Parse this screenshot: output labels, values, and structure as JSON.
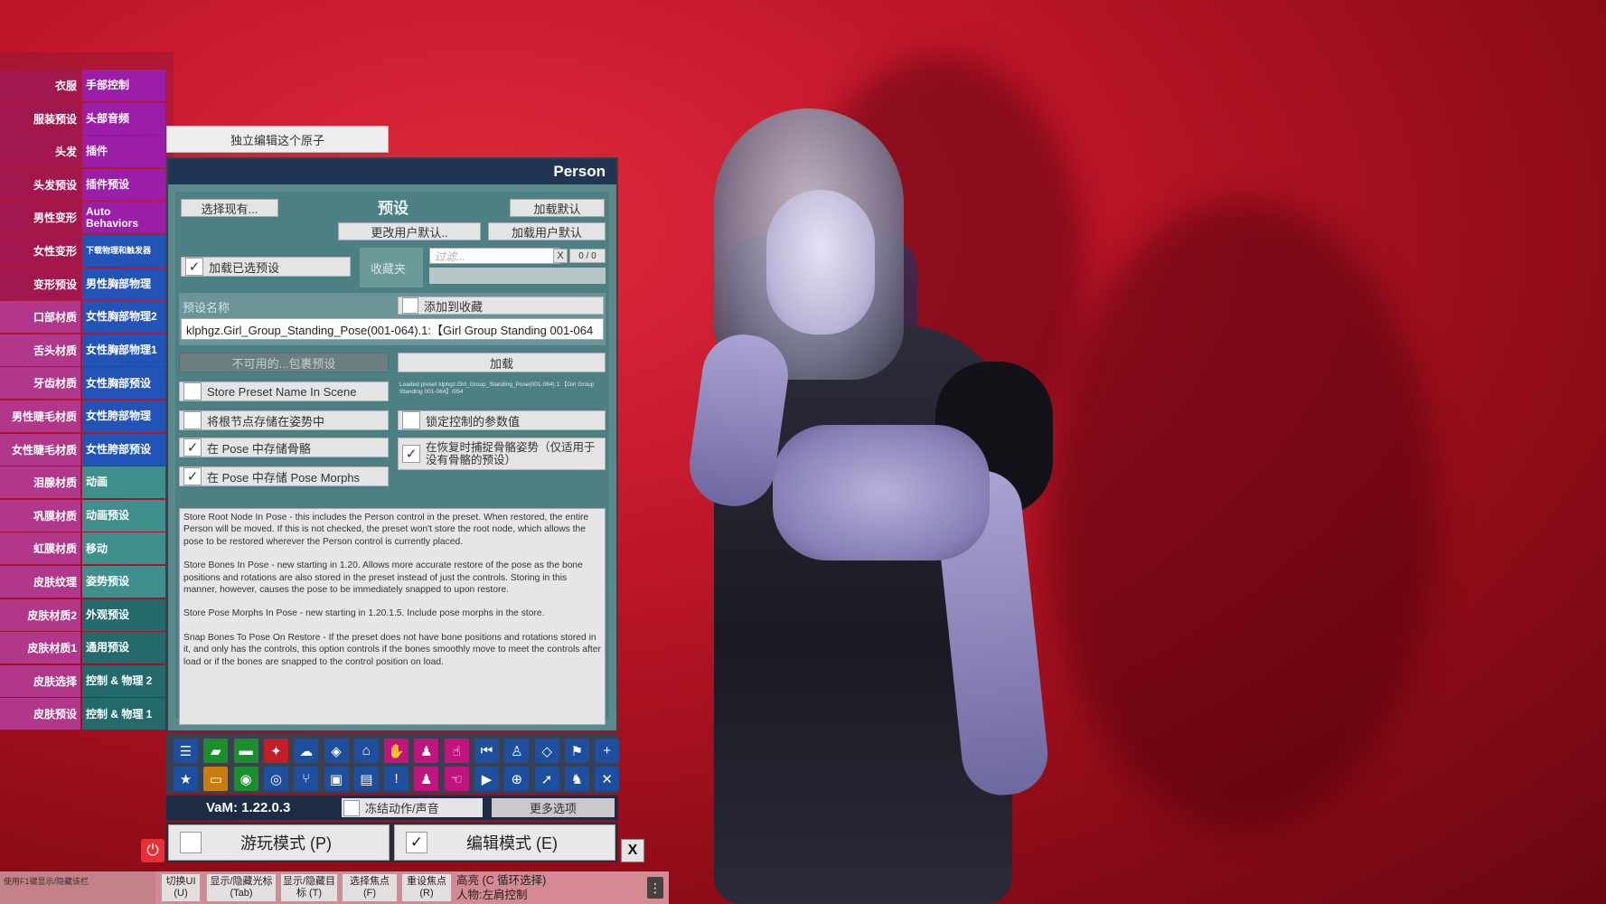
{
  "left_tabs": [
    {
      "left": "衣服",
      "right": "手部控制",
      "left_color": "#a3174f",
      "right_color": "#9b1ea8"
    },
    {
      "left": "服装预设",
      "right": "头部音频",
      "left_color": "#a3174f",
      "right_color": "#9b1ea8"
    },
    {
      "left": "头发",
      "right": "插件",
      "left_color": "#a3174f",
      "right_color": "#9b1ea8"
    },
    {
      "left": "头发预设",
      "right": "插件预设",
      "left_color": "#a3174f",
      "right_color": "#9b1ea8"
    },
    {
      "left": "男性变形",
      "right": "Auto Behaviors",
      "left_color": "#a3174f",
      "right_color": "#9b1ea8"
    },
    {
      "left": "女性变形",
      "right": "下载物理和触发器",
      "left_color": "#a3174f",
      "right_color": "#2254b8"
    },
    {
      "left": "变形预设",
      "right": "男性胸部物理",
      "left_color": "#a3174f",
      "right_color": "#2254b8"
    },
    {
      "left": "口部材质",
      "right": "女性胸部物理2",
      "left_color": "#b0378a",
      "right_color": "#2254b8"
    },
    {
      "left": "舌头材质",
      "right": "女性胸部物理1",
      "left_color": "#b0378a",
      "right_color": "#2254b8"
    },
    {
      "left": "牙齿材质",
      "right": "女性胸部预设",
      "left_color": "#b0378a",
      "right_color": "#2254b8"
    },
    {
      "left": "男性睫毛材质",
      "right": "女性胯部物理",
      "left_color": "#b0378a",
      "right_color": "#2254b8"
    },
    {
      "left": "女性睫毛材质",
      "right": "女性胯部预设",
      "left_color": "#b0378a",
      "right_color": "#2254b8"
    },
    {
      "left": "泪腺材质",
      "right": "动画",
      "left_color": "#b0378a",
      "right_color": "#3f8f8c"
    },
    {
      "left": "巩膜材质",
      "right": "动画预设",
      "left_color": "#b0378a",
      "right_color": "#3f8f8c"
    },
    {
      "left": "虹膜材质",
      "right": "移动",
      "left_color": "#b0378a",
      "right_color": "#3f8f8c"
    },
    {
      "left": "皮肤纹理",
      "right": "姿势预设",
      "left_color": "#b0378a",
      "right_color": "#3f8f8c"
    },
    {
      "left": "皮肤材质2",
      "right": "外观预设",
      "left_color": "#b0378a",
      "right_color": "#246a6c"
    },
    {
      "left": "皮肤材质1",
      "right": "通用预设",
      "left_color": "#b0378a",
      "right_color": "#246a6c"
    },
    {
      "left": "皮肤选择",
      "right": "控制 & 物理 2",
      "left_color": "#b0378a",
      "right_color": "#246a6c"
    },
    {
      "left": "皮肤预设",
      "right": "控制 & 物理 1",
      "left_color": "#b0378a",
      "right_color": "#246a6c"
    }
  ],
  "solo_button": "独立编辑这个原子",
  "panel": {
    "title": "Person",
    "choose_existing": "选择现有...",
    "preset_heading": "预设",
    "load_default": "加载默认",
    "change_user_default": "更改用户默认..",
    "load_user_default": "加载用户默认",
    "load_selected_preset": "加载已选预设",
    "favorites": "收藏夹",
    "filter_placeholder": "过滤...",
    "filter_clear": "X",
    "filter_count": "0 / 0",
    "preset_name_label": "预设名称",
    "add_to_favorites": "添加到收藏",
    "preset_name_value": "klphgz.Girl_Group_Standing_Pose(001-064).1:【Girl Group Standing 001-064",
    "unavailable_package": "不可用的...包裹预设",
    "load": "加载",
    "store_preset_name": "Store Preset Name In Scene",
    "loaded_preset_info": "Loaded preset klphgz.Girl_Group_Standing_Pose(001-064).1:【Girl Group Standing 001-064】/054",
    "store_root_node": "将根节点存储在姿势中",
    "lock_controlled": "锁定控制的参数值",
    "store_bones": "在 Pose 中存储骨骼",
    "capture_bones": "在恢复时捕捉骨骼姿势（仅适用于没有骨骼的预设）",
    "store_pose_morphs": "在 Pose 中存储 Pose Morphs",
    "check": "✓",
    "help_paragraphs": [
      "Store Root Node In Pose - this includes the Person control in the preset. When restored, the entire Person will be moved. If this is not checked, the preset won't store the root node, which allows the pose to be restored wherever the Person control is currently placed.",
      "Store Bones In Pose - new starting in 1.20. Allows more accurate restore of the pose as the bone positions and rotations are also stored in the preset instead of just the controls. Storing in this manner, however, causes the pose to be immediately snapped to upon restore.",
      "Store Pose Morphs In Pose - new starting in 1.20.1.5. Include pose morphs in the store.",
      "Snap Bones To Pose On Restore - If the preset does not have bone positions and rotations stored in it, and only has the controls, this option controls if the bones smoothly move to meet the controls after load or if the bones are snapped to the control position on load."
    ]
  },
  "toolbar": {
    "row1": [
      {
        "name": "menu-icon",
        "glyph": "☰",
        "color": "#1d4f9e"
      },
      {
        "name": "open-scene-icon",
        "glyph": "▰",
        "color": "#1a8f2c"
      },
      {
        "name": "folder-icon",
        "glyph": "▬",
        "color": "#1a8f2c"
      },
      {
        "name": "teleport-icon",
        "glyph": "✦",
        "color": "#c01f2a"
      },
      {
        "name": "cloud-icon",
        "glyph": "☁",
        "color": "#1d4f9e"
      },
      {
        "name": "package-icon",
        "glyph": "◈",
        "color": "#1d4f9e"
      },
      {
        "name": "inbox-icon",
        "glyph": "⌂",
        "color": "#1d4f9e"
      },
      {
        "name": "hand-icon",
        "glyph": "✋",
        "color": "#c0147e"
      },
      {
        "name": "person-add-icon",
        "glyph": "♟",
        "color": "#c0147e"
      },
      {
        "name": "pointer-hand-icon",
        "glyph": "☝",
        "color": "#c0147e"
      },
      {
        "name": "skip-back-icon",
        "glyph": "⏮",
        "color": "#1d4f9e"
      },
      {
        "name": "person-icon",
        "glyph": "♙",
        "color": "#1d4f9e"
      },
      {
        "name": "unity-icon",
        "glyph": "◇",
        "color": "#1d4f9e"
      },
      {
        "name": "flag-icon",
        "glyph": "⚑",
        "color": "#1d4f9e"
      },
      {
        "name": "plus-icon",
        "glyph": "+",
        "color": "#1d4f9e"
      }
    ],
    "row2": [
      {
        "name": "star-icon",
        "glyph": "★",
        "color": "#1d4f9e"
      },
      {
        "name": "open-folder-icon",
        "glyph": "▭",
        "color": "#c97d0c"
      },
      {
        "name": "screenshot-icon",
        "glyph": "◉",
        "color": "#1a8f2c"
      },
      {
        "name": "camera-icon",
        "glyph": "◎",
        "color": "#1d4f9e"
      },
      {
        "name": "branch-icon",
        "glyph": "⑂",
        "color": "#1d4f9e"
      },
      {
        "name": "box-icon",
        "glyph": "▣",
        "color": "#1d4f9e"
      },
      {
        "name": "document-icon",
        "glyph": "▤",
        "color": "#1d4f9e"
      },
      {
        "name": "alert-icon",
        "glyph": "!",
        "color": "#1d4f9e"
      },
      {
        "name": "person-settings-icon",
        "glyph": "♟",
        "color": "#c0147e"
      },
      {
        "name": "grab-hand-icon",
        "glyph": "☜",
        "color": "#c0147e"
      },
      {
        "name": "play-icon",
        "glyph": "▶",
        "color": "#1d4f9e"
      },
      {
        "name": "target-icon",
        "glyph": "⊕",
        "color": "#1d4f9e"
      },
      {
        "name": "cursor-icon",
        "glyph": "➚",
        "color": "#1d4f9e"
      },
      {
        "name": "people-icon",
        "glyph": "♞",
        "color": "#1d4f9e"
      },
      {
        "name": "tools-icon",
        "glyph": "✕",
        "color": "#1d4f9e"
      }
    ],
    "version": "VaM: 1.22.0.3",
    "freeze": "冻结动作/声音",
    "more_options": "更多选项"
  },
  "modes": {
    "play": "游玩模式 (P)",
    "edit": "编辑模式 (E)",
    "check": "✓",
    "close": "X",
    "power": "⏻"
  },
  "status_bar": {
    "hint": "使用F1键显示/隐藏该栏",
    "keys": [
      {
        "line1": "切换UI",
        "line2": "(U)"
      },
      {
        "line1": "显示/隐藏光标",
        "line2": "(Tab)"
      },
      {
        "line1": "显示/隐藏目",
        "line2": "标 (T)"
      },
      {
        "line1": "选择焦点",
        "line2": "(F)"
      },
      {
        "line1": "重设焦点",
        "line2": "(R)"
      }
    ],
    "highlight": "高亮 (C 循环选择)",
    "character": "人物:左肩控制",
    "menu": "⋮"
  }
}
